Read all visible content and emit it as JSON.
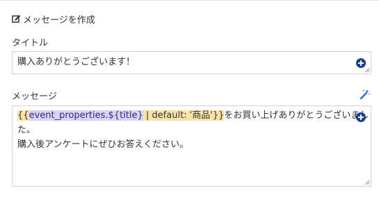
{
  "header": {
    "title": "メッセージを作成",
    "icon": "edit-icon"
  },
  "title_field": {
    "label": "タイトル",
    "value": "購入ありがとうございます！"
  },
  "message_field": {
    "label": "メッセージ",
    "token_open": "{{",
    "token_var": "event_properties.${title}",
    "token_rest": " | default: '商品'}}",
    "line1_rest": "をお買い上げありがとうございまし",
    "line2": "た。",
    "line3": "購入後アンケートにぜひお答えください。"
  },
  "icons": {
    "insert": "plus-circle-icon",
    "magic": "magic-wand-icon",
    "resize": "resize-grip-icon"
  },
  "colors": {
    "accent": "#1b3f8f",
    "magic": "#2a6fd6",
    "token_bg": "#fbe3a8",
    "var_bg": "#d9d4f4"
  }
}
